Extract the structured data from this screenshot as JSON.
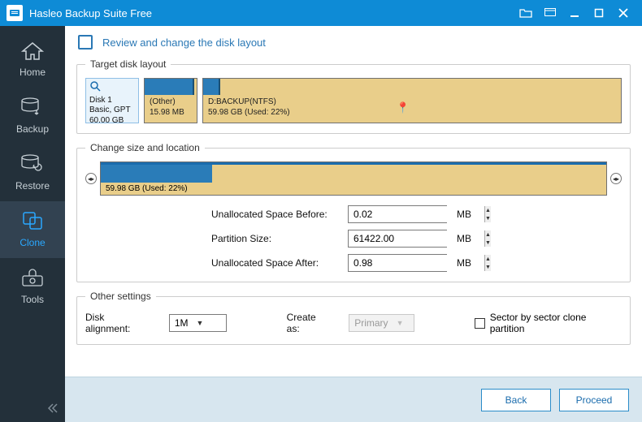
{
  "window": {
    "title": "Hasleo Backup Suite Free"
  },
  "sidebar": {
    "items": [
      {
        "label": "Home"
      },
      {
        "label": "Backup"
      },
      {
        "label": "Restore"
      },
      {
        "label": "Clone"
      },
      {
        "label": "Tools"
      }
    ],
    "active_index": 3
  },
  "header": {
    "title": "Review and change the disk layout"
  },
  "target_layout": {
    "legend": "Target disk layout",
    "disk": {
      "name": "Disk 1",
      "scheme": "Basic, GPT",
      "capacity": "60.00 GB"
    },
    "partitions": [
      {
        "label": "(Other)",
        "size": "15.98 MB",
        "used_pct": 95
      },
      {
        "label": "D:BACKUP(NTFS)",
        "size": "59.98 GB (Used: 22%)",
        "used_pct": 4
      }
    ]
  },
  "resize": {
    "legend": "Change size and location",
    "info": "59.98 GB (Used: 22%)",
    "used_pct": 22,
    "fields": {
      "unalloc_before": {
        "label": "Unallocated Space Before:",
        "value": "0.02",
        "unit": "MB"
      },
      "partition_size": {
        "label": "Partition Size:",
        "value": "61422.00",
        "unit": "MB"
      },
      "unalloc_after": {
        "label": "Unallocated Space After:",
        "value": "0.98",
        "unit": "MB"
      }
    }
  },
  "other": {
    "legend": "Other settings",
    "alignment_label": "Disk alignment:",
    "alignment_value": "1M",
    "create_as_label": "Create as:",
    "create_as_value": "Primary",
    "sector_clone_label": "Sector by sector clone partition",
    "sector_clone_checked": false
  },
  "footer": {
    "back": "Back",
    "proceed": "Proceed"
  }
}
